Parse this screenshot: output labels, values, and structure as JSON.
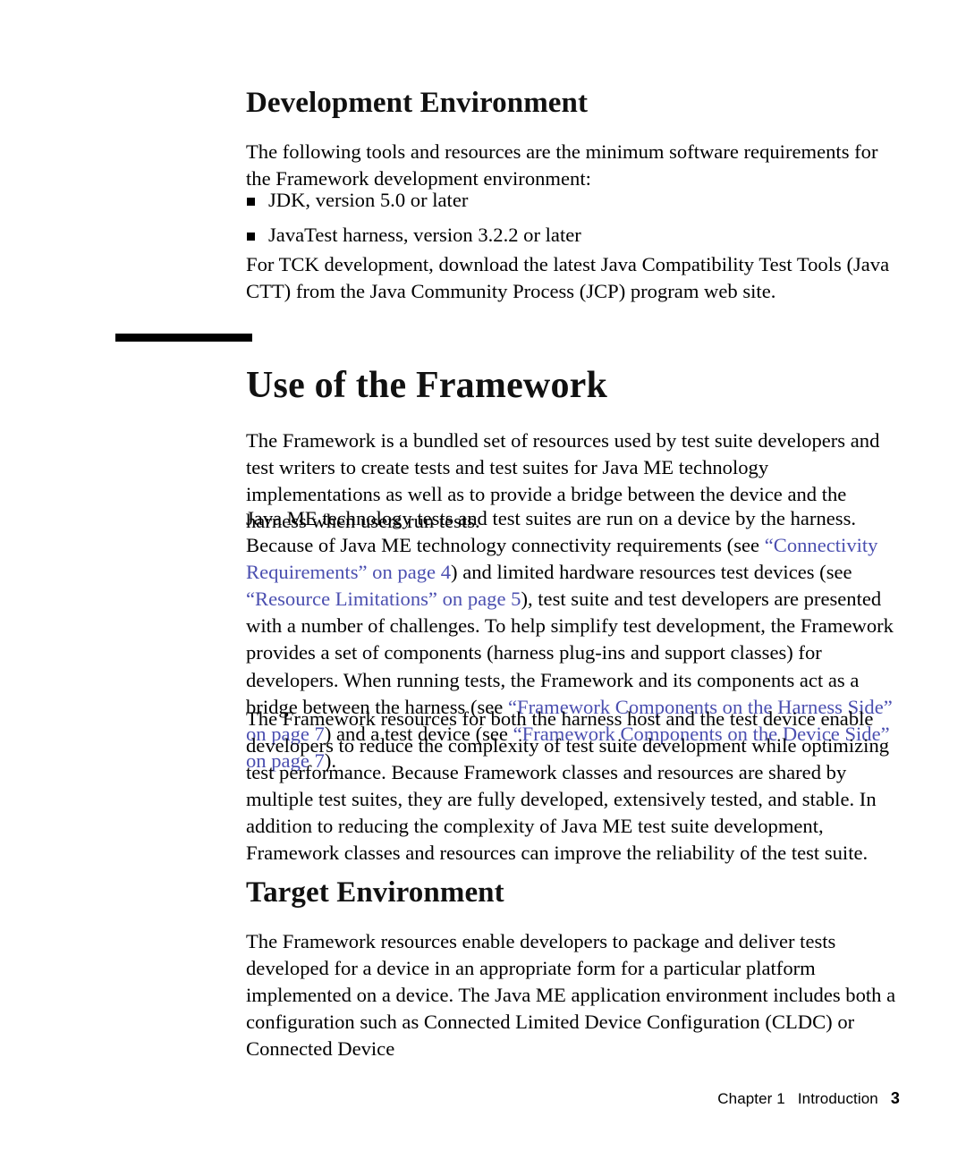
{
  "document": {
    "section1": {
      "heading": "Development Environment",
      "intro": "The following tools and resources are the minimum software requirements for the Framework development environment:",
      "bullets": [
        "JDK, version 5.0 or later",
        "JavaTest harness, version 3.2.2 or later"
      ],
      "after_bullets": "For TCK development, download the latest Java Compatibility Test Tools (Java CTT) from the Java Community Process (JCP) program web site."
    },
    "section2": {
      "heading": "Use of the Framework",
      "paragraph1": "The Framework is a bundled set of resources used by test suite developers and test writers to create tests and test suites for Java ME technology implementations as well as to provide a bridge between the device and the harness when users run tests.",
      "paragraph2": {
        "part1": "Java ME technology tests and test suites are run on a device by the harness. Because of Java ME technology connectivity requirements (see ",
        "link1": "“Connectivity Requirements” on page 4",
        "part2": ") and limited hardware resources test devices (see ",
        "link2": "“Resource Limitations” on page 5",
        "part3": "), test suite and test developers are presented with a number of challenges. To help simplify test development, the Framework provides a set of components (harness plug-ins and support classes) for developers. When running tests, the Framework and its components act as a bridge between the harness (see ",
        "link3": "“Framework Components on the Harness Side” on page 7",
        "part4": ") and a test device (see ",
        "link4": "“Framework Components on the Device Side” on page 7",
        "part5": ")."
      },
      "paragraph3": "The Framework resources for both the harness host and the test device enable developers to reduce the complexity of test suite development while optimizing test performance. Because Framework classes and resources are shared by multiple test suites, they are fully developed, extensively tested, and stable. In addition to reducing the complexity of Java ME test suite development, Framework classes and resources can improve the reliability of the test suite."
    },
    "section3": {
      "heading": "Target Environment",
      "paragraph1": "The Framework resources enable developers to package and deliver tests developed for a device in an appropriate form for a particular platform implemented on a device. The Java ME application environment includes both a configuration such as Connected Limited Device Configuration (CLDC) or Connected Device"
    },
    "footer": {
      "chapter": "Chapter 1",
      "title": "Introduction",
      "page_number": "3"
    },
    "colors": {
      "text": "#000000",
      "link": "#4b4fb0",
      "rule": "#000000",
      "background": "#ffffff"
    }
  }
}
